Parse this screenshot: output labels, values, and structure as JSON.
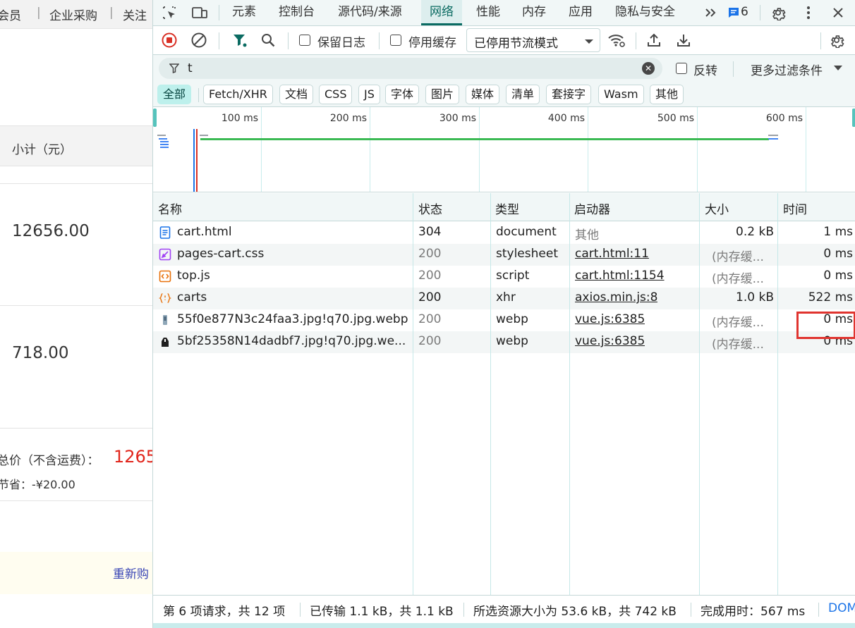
{
  "page": {
    "topbar": {
      "item1": "会员",
      "item2": "企业采购",
      "item3": "关注"
    },
    "subtotal_header": "小计（元）",
    "prices": [
      "12656.00",
      "718.00"
    ],
    "total_label": "总价（不含运费）：",
    "total_value": "1265",
    "saving": "节省：-¥20.00",
    "rebuy": "重新购"
  },
  "devtools": {
    "tabs": [
      {
        "label": "元素"
      },
      {
        "label": "控制台"
      },
      {
        "label": "源代码/来源"
      },
      {
        "label": "网络",
        "active": true
      },
      {
        "label": "性能"
      },
      {
        "label": "内存"
      },
      {
        "label": "应用"
      },
      {
        "label": "隐私与安全"
      }
    ],
    "issues_count": "6",
    "toolbar": {
      "preserve_log": "保留日志",
      "disable_cache": "停用缓存",
      "throttle_value": "已停用节流模式"
    },
    "filter": {
      "value": "t",
      "invert_label": "反转",
      "more_filters": "更多过滤条件"
    },
    "type_chips": [
      "全部",
      "Fetch/XHR",
      "文档",
      "CSS",
      "JS",
      "字体",
      "图片",
      "媒体",
      "清单",
      "套接字",
      "Wasm",
      "其他"
    ],
    "timeline_ticks": [
      "100 ms",
      "200 ms",
      "300 ms",
      "400 ms",
      "500 ms",
      "600 ms"
    ],
    "columns": {
      "name": "名称",
      "status": "状态",
      "type": "类型",
      "initiator": "启动器",
      "size": "大小",
      "time": "时间"
    },
    "rows": [
      {
        "name": "cart.html",
        "icon": "document-icon",
        "status": "304",
        "type": "document",
        "initiator": "其他",
        "size": "0.2 kB",
        "time": "1 ms"
      },
      {
        "name": "pages-cart.css",
        "icon": "stylesheet-icon",
        "status": "200",
        "type": "stylesheet",
        "initiator": "cart.html:11",
        "size": "(内存缓...",
        "time": "0 ms"
      },
      {
        "name": "top.js",
        "icon": "script-icon",
        "status": "200",
        "type": "script",
        "initiator": "cart.html:1154",
        "size": "(内存缓...",
        "time": "0 ms"
      },
      {
        "name": "carts",
        "icon": "xhr-icon",
        "status": "200",
        "type": "xhr",
        "initiator": "axios.min.js:8",
        "size": "1.0 kB",
        "time": "522 ms"
      },
      {
        "name": "55f0e877N3c24faa3.jpg!q70.jpg.webp",
        "icon": "image-thumbnail-icon",
        "status": "200",
        "type": "webp",
        "initiator": "vue.js:6385",
        "size": "(内存缓...",
        "time": "0 ms"
      },
      {
        "name": "5bf25358N14dadbf7.jpg!q70.jpg.we...",
        "icon": "image-thumbnail-icon",
        "status": "200",
        "type": "webp",
        "initiator": "vue.js:6385",
        "size": "(内存缓...",
        "time": "0 ms"
      }
    ],
    "status": {
      "requests": "第 6 项请求，共 12 项",
      "transferred": "已传输 1.1 kB，共 1.1 kB",
      "resources": "所选资源大小为 53.6 kB，共 742 kB",
      "finish": "完成用时：567 ms",
      "dom": "DOM"
    }
  }
}
